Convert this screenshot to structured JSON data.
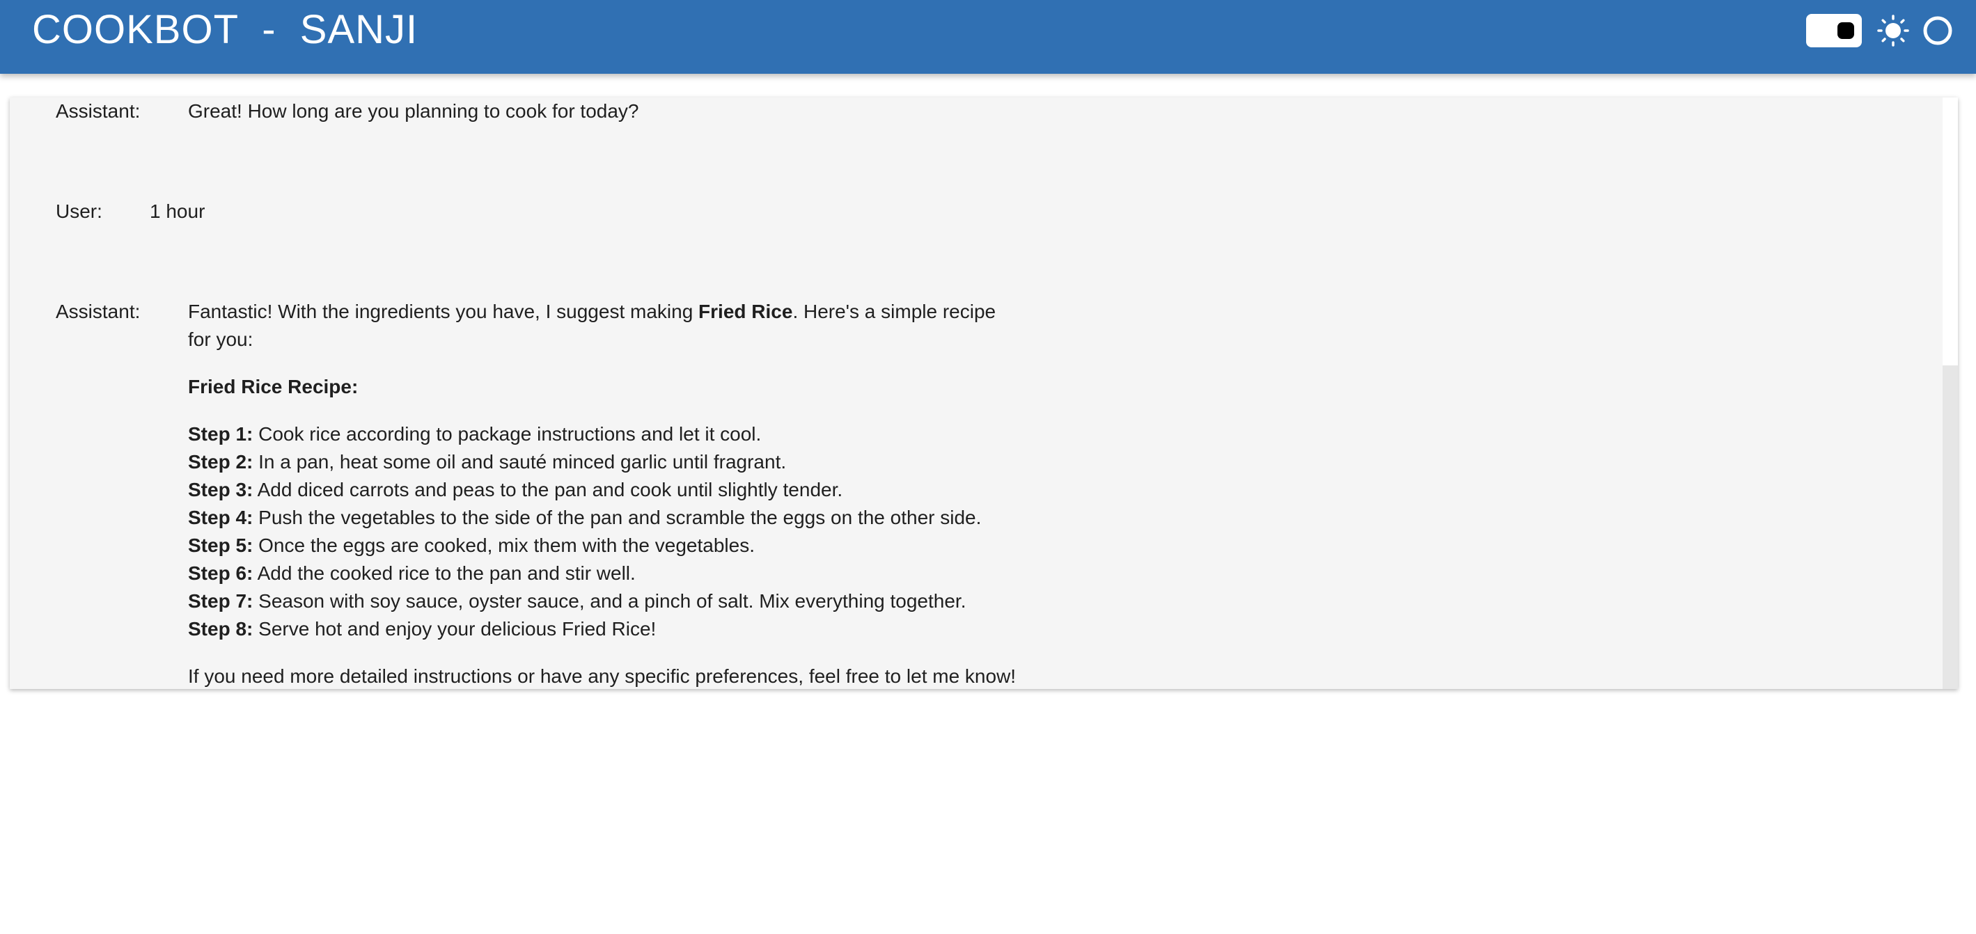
{
  "header": {
    "title": "COOKBOT  -  SANJI",
    "controls": {
      "toggle_icon": "theme-toggle",
      "sun_icon": "sun-icon",
      "circle_icon": "circle-icon"
    }
  },
  "chat": {
    "messages": [
      {
        "role": "Assistant:",
        "text": "Great! How long are you planning to cook for today?"
      },
      {
        "role": "User:",
        "text": "1 hour"
      },
      {
        "role": "Assistant:",
        "intro_before": "Fantastic! With the ingredients you have, I suggest making ",
        "intro_bold": "Fried Rice",
        "intro_after": ". Here's a simple recipe",
        "intro_line2": "for you:",
        "recipe_title": "Fried Rice Recipe:",
        "steps": [
          {
            "label": "Step 1:",
            "text": " Cook rice according to package instructions and let it cool."
          },
          {
            "label": "Step 2:",
            "text": " In a pan, heat some oil and sauté minced garlic until fragrant."
          },
          {
            "label": "Step 3:",
            "text": " Add diced carrots and peas to the pan and cook until slightly tender."
          },
          {
            "label": "Step 4:",
            "text": " Push the vegetables to the side of the pan and scramble the eggs on the other side."
          },
          {
            "label": "Step 5:",
            "text": " Once the eggs are cooked, mix them with the vegetables."
          },
          {
            "label": "Step 6:",
            "text": " Add the cooked rice to the pan and stir well."
          },
          {
            "label": "Step 7:",
            "text": " Season with soy sauce, oyster sauce, and a pinch of salt. Mix everything together."
          },
          {
            "label": "Step 8:",
            "text": " Serve hot and enjoy your delicious Fried Rice!"
          }
        ],
        "outro": "If you need more detailed instructions or have any specific preferences, feel free to let me know!"
      }
    ]
  },
  "colors": {
    "header_bg": "#3070b3",
    "panel_bg": "#f5f5f5",
    "text": "#1f1f1f"
  }
}
